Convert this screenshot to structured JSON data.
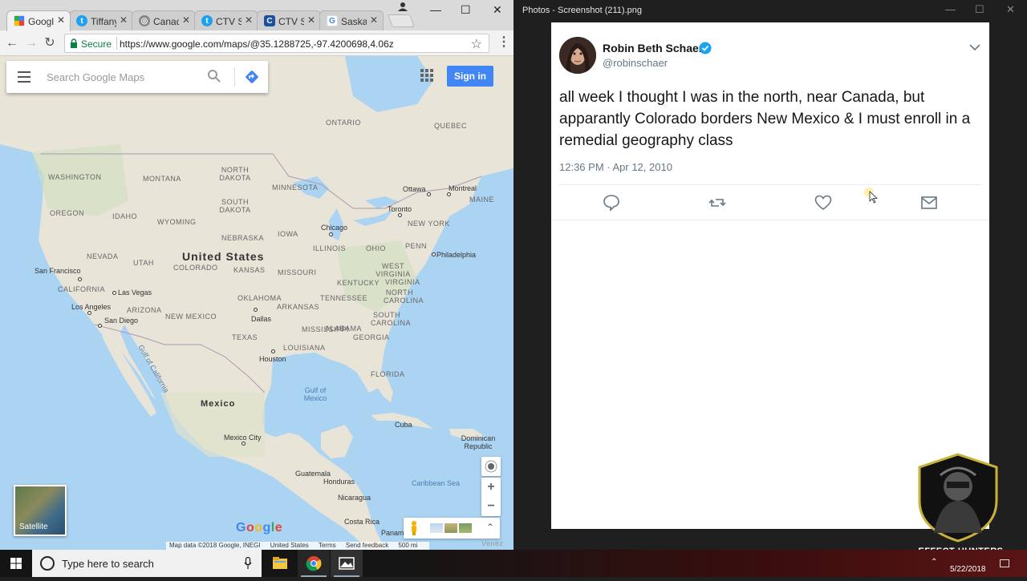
{
  "browser": {
    "tabs": [
      {
        "title": "Google",
        "favicon": "google-maps-favicon",
        "color": "#34a853",
        "active": true
      },
      {
        "title": "Tiffany",
        "favicon": "twitter-favicon",
        "color": "#1da1f2"
      },
      {
        "title": "Canada",
        "favicon": "globe-favicon",
        "color": "#888888"
      },
      {
        "title": "CTV Sa",
        "favicon": "twitter-favicon",
        "color": "#1da1f2"
      },
      {
        "title": "CTV Sa",
        "favicon": "ctv-favicon",
        "color": "#1b4fa0"
      },
      {
        "title": "Saskat",
        "favicon": "google-favicon",
        "color": "#4285f4"
      }
    ],
    "close_glyph": "✕",
    "window_controls": {
      "minimize": "—",
      "maximize": "☐",
      "close": "✕"
    },
    "secure_label": "Secure",
    "url": "https://www.google.com/maps/@35.1288725,-97.4200698,4.06z"
  },
  "maps": {
    "search_placeholder": "Search Google Maps",
    "signin_label": "Sign in",
    "satellite_label": "Satellite",
    "google_logo": "Google",
    "zoom_in": "+",
    "zoom_out": "−",
    "footer": [
      "Map data ©2018 Google, INEGI",
      "United States",
      "Terms",
      "Send feedback",
      "500 mi"
    ],
    "state_labels": [
      "WASHINGTON",
      "OREGON",
      "IDAHO",
      "MONTANA",
      "WYOMING",
      "NEVADA",
      "UTAH",
      "COLORADO",
      "CALIFORNIA",
      "ARIZONA",
      "NEW MEXICO",
      "NORTH DAKOTA",
      "SOUTH DAKOTA",
      "NEBRASKA",
      "KANSAS",
      "OKLAHOMA",
      "TEXAS",
      "MINNESOTA",
      "IOWA",
      "MISSOURI",
      "ARKANSAS",
      "LOUISIANA",
      "MISSISSIPPI",
      "ALABAMA",
      "TENNESSEE",
      "KENTUCKY",
      "ILLINOIS",
      "OHIO",
      "PENN",
      "NEW YORK",
      "WEST VIRGINIA",
      "VIRGINIA",
      "NORTH CAROLINA",
      "SOUTH CAROLINA",
      "GEORGIA",
      "FLORIDA",
      "ONTARIO",
      "QUEBEC",
      "MAINE"
    ],
    "cities": [
      "San Francisco",
      "Los Angeles",
      "San Diego",
      "Las Vegas",
      "Dallas",
      "Houston",
      "Chicago",
      "Toronto",
      "Ottawa",
      "Montreal",
      "Philadelphia",
      "Mexico City",
      "Guatemala",
      "Honduras",
      "Nicaragua",
      "Costa Rica",
      "Panam",
      "Cuba",
      "Dominican Republic"
    ],
    "countries": [
      "United States",
      "Mexico"
    ],
    "waters": [
      "Gulf of Mexico",
      "Gulf of California",
      "Caribbean Sea"
    ],
    "partial_label": "Venez"
  },
  "photos": {
    "title": "Photos - Screenshot (211).png",
    "window_controls": {
      "minimize": "—",
      "maximize": "☐",
      "close": "✕"
    }
  },
  "tweet": {
    "author_name": "Robin Beth Schaer",
    "handle": "@robinschaer",
    "text": "all week I thought I was in the north, near Canada, but apparantly Colorado borders New Mexico & I must enroll in a remedial geography class",
    "timestamp": "12:36 PM · Apr 12, 2010",
    "verified_color": "#1da1f2",
    "actions": [
      "reply-icon",
      "retweet-icon",
      "like-icon",
      "message-icon"
    ]
  },
  "watermark": {
    "label": "EFFECT HUNTERS"
  },
  "taskbar": {
    "search_text": "Type here to search",
    "date": "5/22/2018",
    "tray_up": "⌃",
    "apps": [
      "file-explorer-icon",
      "chrome-icon",
      "photos-icon"
    ]
  }
}
